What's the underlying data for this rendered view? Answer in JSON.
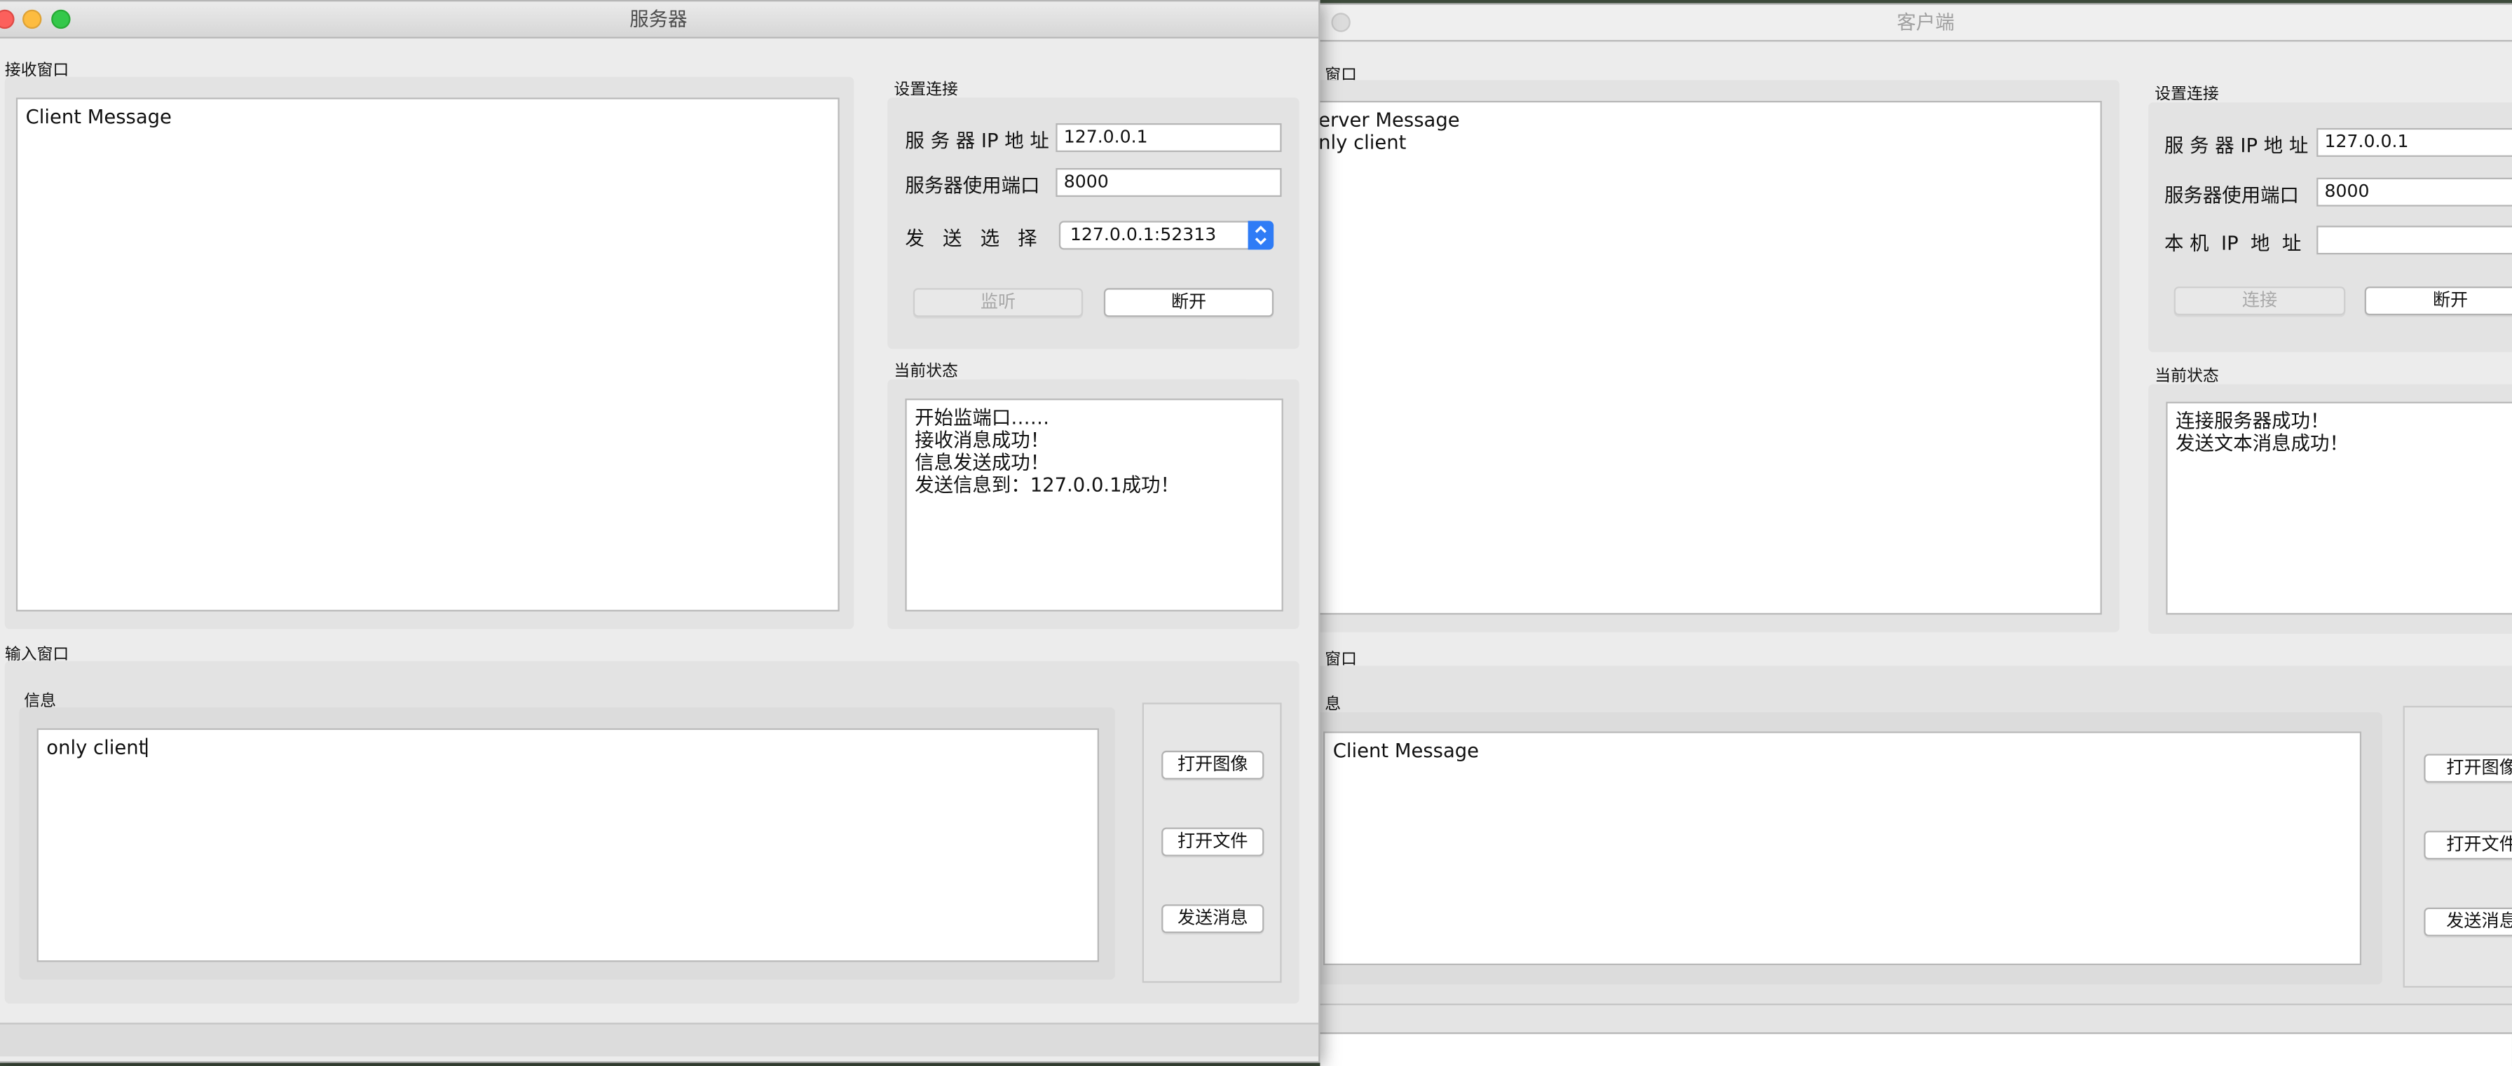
{
  "server": {
    "title": "服务器",
    "receive_label": "接收窗口",
    "receive_lines": [
      "Client Message"
    ],
    "settings_label": "设置连接",
    "ip_label": "服 务 器 IP 地 址",
    "ip_value": "127.0.0.1",
    "port_label": "服务器使用端口",
    "port_value": "8000",
    "send_select_label": "发   送   选   择",
    "send_select_value": "127.0.0.1:52313",
    "listen_button": "监听",
    "disconnect_button": "断开",
    "status_label": "当前状态",
    "status_lines": [
      "开始监端口……",
      "接收消息成功！",
      "信息发送成功！",
      "发送信息到：127.0.0.1成功！"
    ],
    "input_label": "输入窗口",
    "message_label": "信息",
    "message_value": "only client",
    "open_image_button": "打开图像",
    "open_file_button": "打开文件",
    "send_message_button": "发送消息"
  },
  "client": {
    "title": "客户端",
    "receive_label": "窗口",
    "receive_lines": [
      "erver Message",
      "nly client"
    ],
    "settings_label": "设置连接",
    "ip_label": "服 务 器 IP 地 址",
    "ip_value": "127.0.0.1",
    "port_label": "服务器使用端口",
    "port_value": "8000",
    "local_ip_label": "本 机  IP  地  址",
    "local_ip_value": "",
    "connect_button": "连接",
    "disconnect_button": "断开",
    "status_label": "当前状态",
    "status_lines": [
      "连接服务器成功！",
      "发送文本消息成功！"
    ],
    "input_label": "窗口",
    "message_label": "息",
    "message_value": "Client Message",
    "open_image_button": "打开图像",
    "open_file_button": "打开文件",
    "send_message_button": "发送消息"
  }
}
